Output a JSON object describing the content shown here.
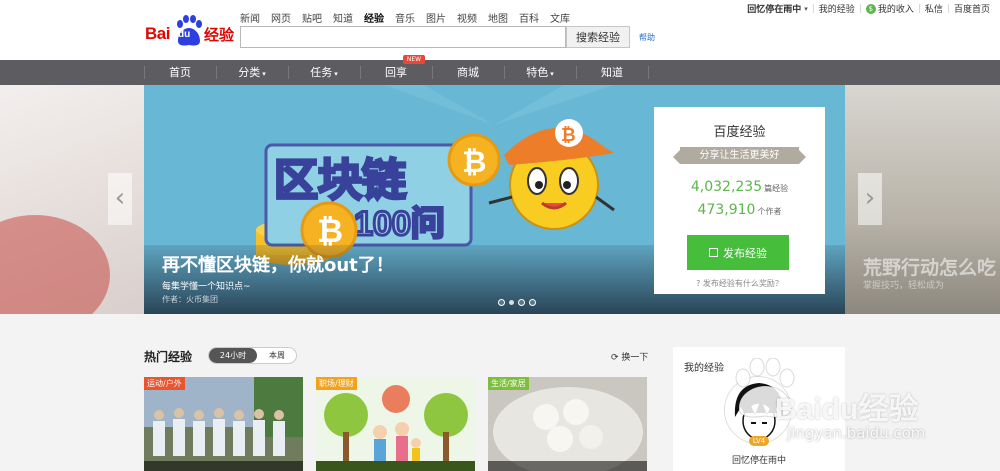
{
  "logo": {
    "bai": "Bai",
    "du": "du",
    "jingyan": "经验"
  },
  "header": {
    "links": [
      "新闻",
      "网页",
      "贴吧",
      "知道",
      "经验",
      "音乐",
      "图片",
      "视频",
      "地图",
      "百科",
      "文库"
    ],
    "active_link": "经验",
    "search_placeholder": "",
    "search_button": "搜索经验",
    "help": "帮助"
  },
  "userbar": {
    "username": "回忆停在雨中",
    "my_jingyan": "我的经验",
    "my_income": "我的收入",
    "messages": "私信",
    "home": "百度首页"
  },
  "mainnav": {
    "items": [
      {
        "label": "首页",
        "arrow": ""
      },
      {
        "label": "分类",
        "arrow": "▾"
      },
      {
        "label": "任务",
        "arrow": "▾"
      },
      {
        "label": "回享",
        "arrow": ""
      },
      {
        "label": "商城",
        "arrow": ""
      },
      {
        "label": "特色",
        "arrow": "▾"
      },
      {
        "label": "知道",
        "arrow": ""
      }
    ],
    "new_badge": "NEW"
  },
  "banner": {
    "graphic_title": "区块链",
    "graphic_sub": "100问",
    "title": "再不懂区块链，你就out了！",
    "subtitle": "每集学懂一个知识点~",
    "author": "作者：火币集团",
    "slide_count": 4,
    "active_slide": 2,
    "right_peek_title": "荒野行动怎么吃",
    "right_peek_sub": "掌握技巧，轻松成为"
  },
  "promo": {
    "title": "百度经验",
    "slogan": "分享让生活更美好",
    "articles_count": "4,032,235",
    "articles_unit": "篇经验",
    "authors_count": "473,910",
    "authors_unit": "个作者",
    "publish_button": "发布经验",
    "reward_note": "发布经验有什么奖励？"
  },
  "hot": {
    "title": "热门经验",
    "tab_active": "24小时",
    "tab_other": "本周",
    "refresh": "换一下",
    "cards": [
      {
        "tag": "运动/户外",
        "tag_color": "#e8552f"
      },
      {
        "tag": "职场/理财",
        "tag_color": "#f3a21b"
      },
      {
        "tag": "生活/家居",
        "tag_color": "#7cbf3a"
      }
    ]
  },
  "mine": {
    "title": "我的经验",
    "level": "LV4",
    "name": "回忆停在雨中"
  },
  "watermark": {
    "brand": "Baidu经验",
    "url": "jingyan.baidu.com"
  },
  "colors": {
    "brand_red": "#e10602",
    "nav_gray": "#5c5c61",
    "green": "#47bd3c",
    "banner_blue": "#68b7d4"
  }
}
